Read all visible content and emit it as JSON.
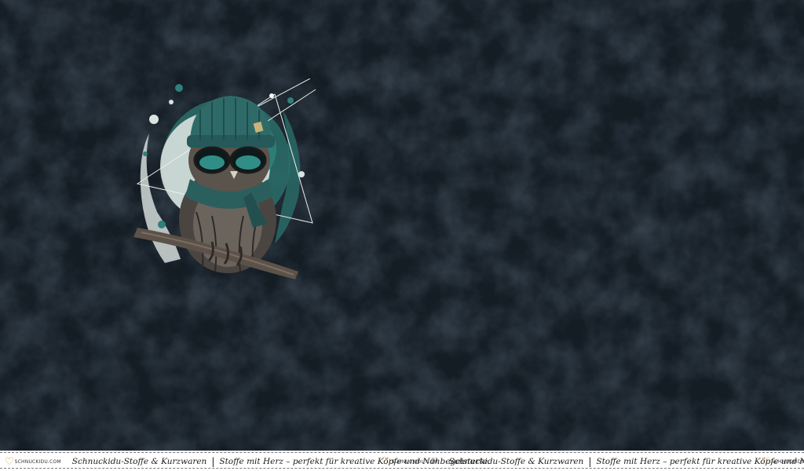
{
  "image": {
    "subject": "owl wearing a beanie and sunglasses perched on a branch",
    "background_color": "#141c24",
    "accent_color": "#2f7f7a"
  },
  "selvedge": {
    "logo_text": "SCHNUCKIDU.COM",
    "brand": "Schnuckidu-Stoffe & Kurzwaren",
    "separator": "|",
    "tagline": "Stoffe mit Herz – perfekt für kreative Köpfe und Nähbegeisterte."
  }
}
